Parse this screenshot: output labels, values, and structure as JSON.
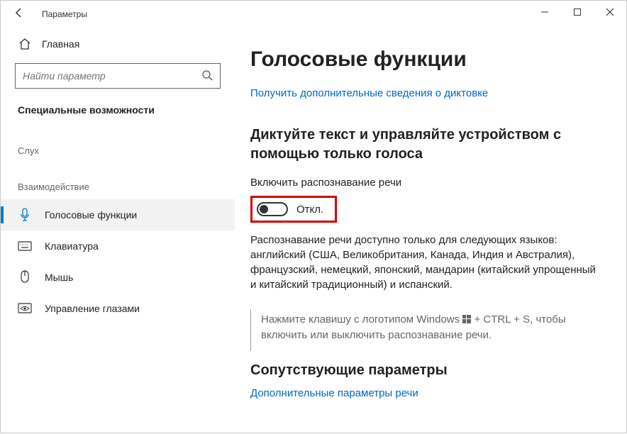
{
  "window": {
    "title": "Параметры"
  },
  "sidebar": {
    "home": "Главная",
    "search_placeholder": "Найти параметр",
    "section": "Специальные возможности",
    "groups": [
      {
        "label": "Слух",
        "items": []
      },
      {
        "label": "Взаимодействие",
        "items": [
          {
            "label": "Голосовые функции",
            "icon": "mic",
            "active": true
          },
          {
            "label": "Клавиатура",
            "icon": "keyboard",
            "active": false
          },
          {
            "label": "Мышь",
            "icon": "mouse",
            "active": false
          },
          {
            "label": "Управление глазами",
            "icon": "eye-control",
            "active": false
          }
        ]
      }
    ]
  },
  "content": {
    "title": "Голосовые функции",
    "top_link": "Получить дополнительные сведения о диктовке",
    "subhead": "Диктуйте текст и управляйте устройством с помощью только голоса",
    "toggle_label": "Включить распознавание речи",
    "toggle_state": "Откл.",
    "description": "Распознавание речи доступно только для следующих языков: английский (США, Великобритания, Канада, Индия и Австралия), французский, немецкий, японский, мандарин (китайский упрощенный и китайский традиционный) и испанский.",
    "hint_pre": "Нажмите клавишу с логотипом Windows ",
    "hint_post": " + CTRL + S, чтобы включить или выключить распознавание речи.",
    "related_head": "Сопутствующие параметры",
    "related_link": "Дополнительные параметры речи"
  }
}
